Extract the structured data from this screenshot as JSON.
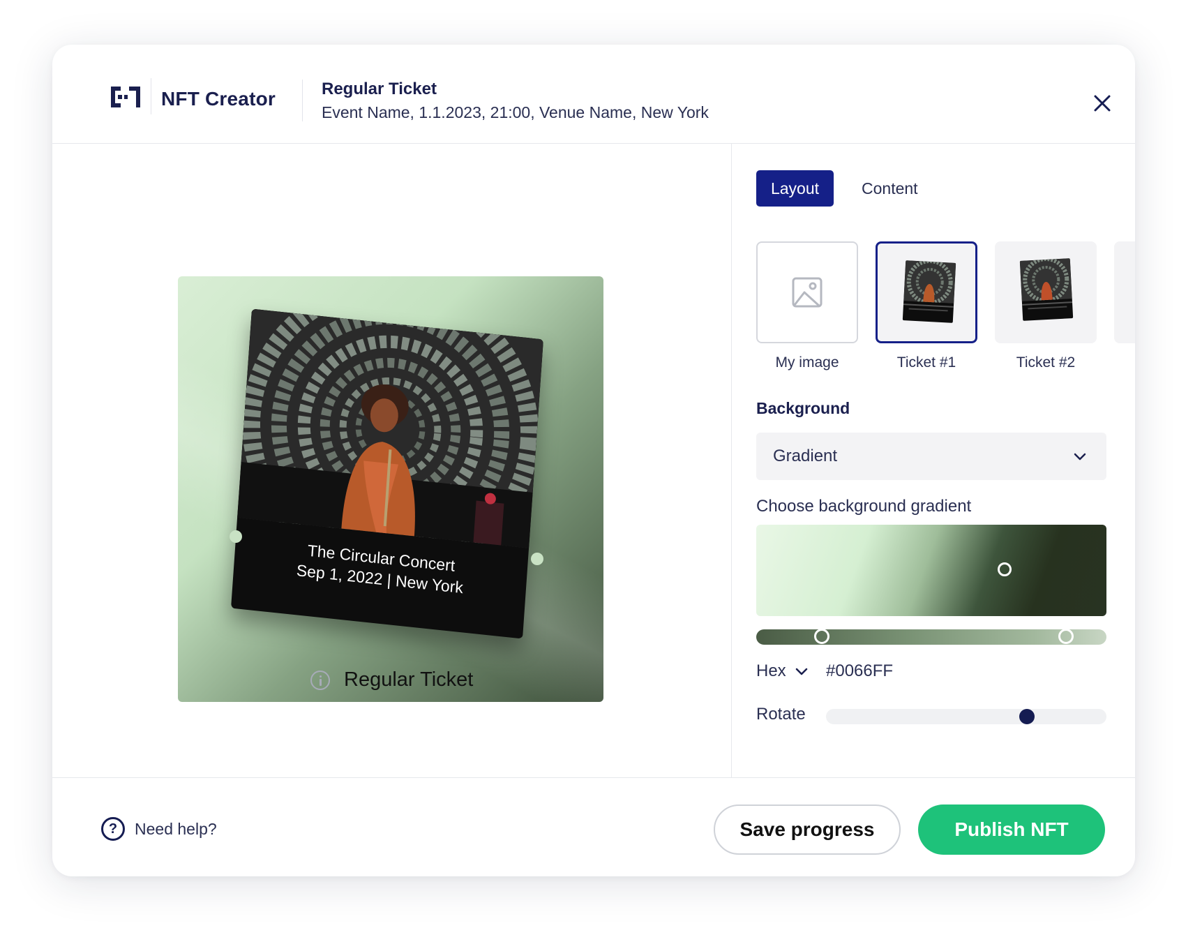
{
  "header": {
    "brand": "NFT Creator",
    "ticket_title": "Regular Ticket",
    "event_info": "Event Name, 1.1.2023, 21:00, Venue Name, New York"
  },
  "preview": {
    "ticket_line1": "The Circular Concert",
    "ticket_line2": "Sep 1, 2022 | New York",
    "caption": "Regular Ticket"
  },
  "tabs": [
    {
      "label": "Layout",
      "active": true
    },
    {
      "label": "Content",
      "active": false
    }
  ],
  "templates": [
    {
      "label": "My image",
      "selected": false
    },
    {
      "label": "Ticket #1",
      "selected": true
    },
    {
      "label": "Ticket #2",
      "selected": false
    }
  ],
  "background": {
    "section_label": "Background",
    "selected": "Gradient",
    "gradient_label": "Choose background gradient",
    "hex_label": "Hex",
    "hex_value": "#0066FF",
    "rotate_label": "Rotate",
    "rotate_value": 0.73
  },
  "footer": {
    "help": "Need help?",
    "save": "Save progress",
    "publish": "Publish NFT"
  },
  "icons": {
    "logo": "logo-icon",
    "close": "close-icon",
    "info": "info-icon",
    "image": "image-placeholder-icon",
    "chevron": "chevron-down-icon",
    "help": "help-circle-icon"
  },
  "colors": {
    "brand_navy": "#152088",
    "publish_green": "#1ec27a",
    "text_dark": "#1a1f4e"
  }
}
